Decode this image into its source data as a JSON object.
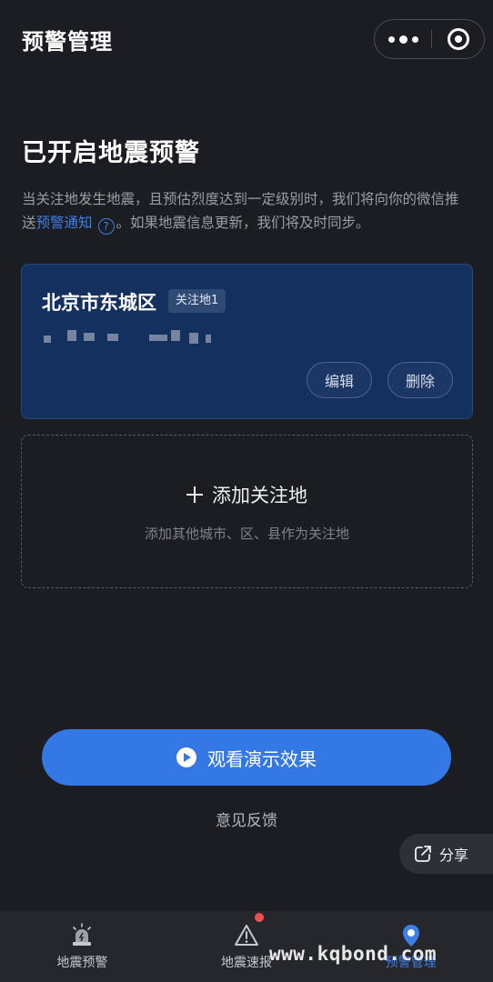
{
  "header": {
    "title": "预警管理"
  },
  "main": {
    "section_title": "已开启地震预警",
    "description_part1": "当关注地发生地震，且预估烈度达到一定级别时，我们将向你的微信推送",
    "description_link": "预警通知",
    "description_help": "?",
    "description_part2": "。如果地震信息更新，我们将及时同步。"
  },
  "location_card": {
    "city": "北京市东城区",
    "badge": "关注地1",
    "edit_label": "编辑",
    "delete_label": "删除"
  },
  "add_card": {
    "title": "添加关注地",
    "subtitle": "添加其他城市、区、县作为关注地"
  },
  "demo_button": {
    "label": "观看演示效果"
  },
  "feedback_label": "意见反馈",
  "share_label": "分享",
  "tabbar": {
    "items": [
      {
        "label": "地震预警",
        "icon": "alarm-icon"
      },
      {
        "label": "地震速报",
        "icon": "warning-triangle-icon"
      },
      {
        "label": "预警管理",
        "icon": "location-pin-icon"
      }
    ]
  },
  "watermark": "www.kqbond.com",
  "colors": {
    "accent": "#3478e6",
    "background": "#1b1d22",
    "card": "#14305e",
    "badge_dot": "#f04e4e"
  }
}
